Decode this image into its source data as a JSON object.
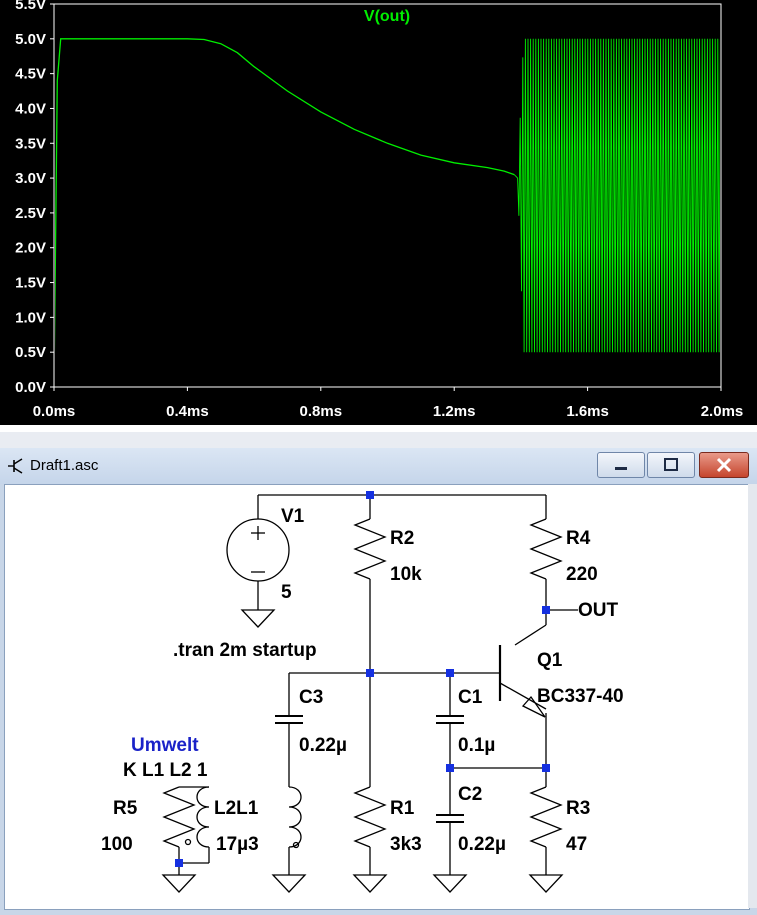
{
  "chart_data": {
    "type": "line",
    "title": "V(out)",
    "xlabel": "",
    "ylabel": "",
    "xlim": [
      0.0,
      2.0
    ],
    "ylim": [
      0.0,
      5.5
    ],
    "x_ticks": [
      "0.0ms",
      "0.4ms",
      "0.8ms",
      "1.2ms",
      "1.6ms",
      "2.0ms"
    ],
    "y_ticks": [
      "0.0V",
      "0.5V",
      "1.0V",
      "1.5V",
      "2.0V",
      "2.5V",
      "3.0V",
      "3.5V",
      "4.0V",
      "4.5V",
      "5.0V",
      "5.5V"
    ],
    "grid": false,
    "series": [
      {
        "name": "V(out)",
        "color": "#00ee00",
        "x": [
          0.0,
          0.01,
          0.02,
          0.05,
          0.1,
          0.2,
          0.3,
          0.4,
          0.45,
          0.5,
          0.55,
          0.6,
          0.7,
          0.8,
          0.9,
          1.0,
          1.1,
          1.2,
          1.3,
          1.35,
          1.38
        ],
        "y": [
          0.0,
          4.4,
          5.0,
          5.0,
          5.0,
          5.0,
          5.0,
          5.0,
          4.99,
          4.93,
          4.8,
          4.6,
          4.25,
          3.95,
          3.7,
          3.5,
          3.33,
          3.22,
          3.15,
          3.1,
          3.05
        ]
      }
    ],
    "oscillation": {
      "x_start": 1.39,
      "x_end": 2.0,
      "min": 0.5,
      "max": 5.0
    }
  },
  "window": {
    "title": "Draft1.asc",
    "buttons": {
      "minimize": "minimize-button",
      "maximize": "maximize-button",
      "close": "close-button"
    }
  },
  "schematic": {
    "v1_name": "V1",
    "v1_value": "5",
    "r2_name": "R2",
    "r2_value": "10k",
    "r4_name": "R4",
    "r4_value": "220",
    "out_label": "OUT",
    "directive": ".tran 2m startup",
    "q1_name": "Q1",
    "q1_value": "BC337-40",
    "c3_name": "C3",
    "c3_value": "0.22µ",
    "c1_name": "C1",
    "c1_value": "0.1µ",
    "c2_name": "C2",
    "c2_value": "0.22µ",
    "umwelt_label": "Umwelt",
    "coupling": "K L1 L2 1",
    "r5_name": "R5",
    "r5_value": "100",
    "l2l1_name": "L2L1",
    "l_value": "17µ3",
    "r1_name": "R1",
    "r1_value": "3k3",
    "r3_name": "R3",
    "r3_value": "47"
  }
}
